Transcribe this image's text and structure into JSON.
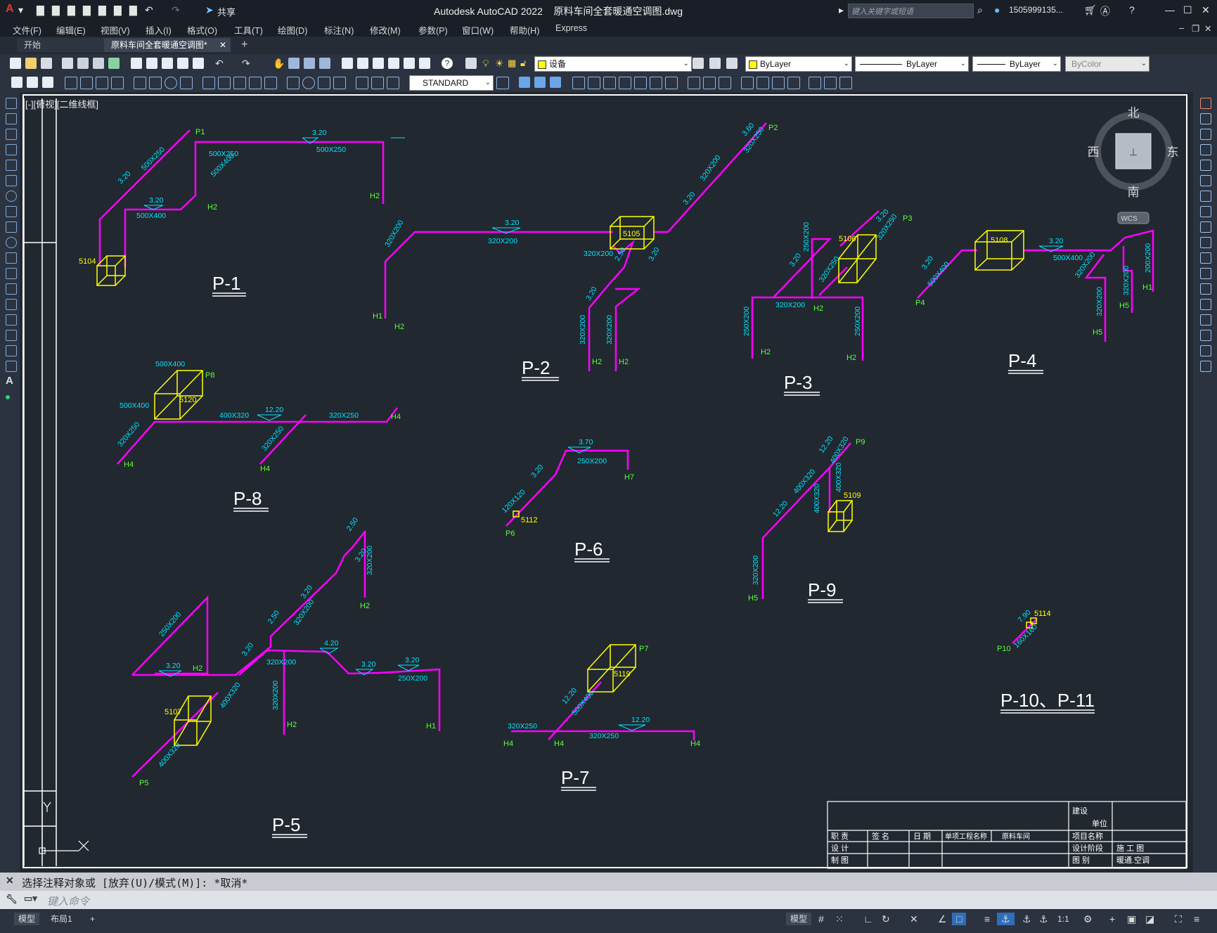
{
  "app": {
    "logo": "A",
    "title": "Autodesk AutoCAD 2022    原料车间全套暖通空调图.dwg",
    "share_label": "共享",
    "search_placeholder": "键入关键字或短语",
    "user": "1505999135...",
    "colors": {
      "duct": "#ff00ff",
      "text": "#00e5ff",
      "label": "#5cff3a",
      "equip": "#ffff00",
      "bg": "#212830"
    }
  },
  "menu": [
    "文件(F)",
    "编辑(E)",
    "视图(V)",
    "插入(I)",
    "格式(O)",
    "工具(T)",
    "绘图(D)",
    "标注(N)",
    "修改(M)",
    "参数(P)",
    "窗口(W)",
    "帮助(H)",
    "Express"
  ],
  "tabs": {
    "start": "开始",
    "active": "原料车间全套暖通空调图*",
    "add": "+"
  },
  "toolbar": {
    "layer": "设备",
    "color": "ByLayer",
    "linetype": "ByLayer",
    "lineweight": "ByLayer",
    "plotstyle": "ByColor",
    "textstyle": "STANDARD"
  },
  "viewport": {
    "label": "[-][俯视][二维线框]",
    "compass": {
      "n": "北",
      "s": "南",
      "e": "东",
      "w": "西"
    },
    "ucs": "WCS"
  },
  "drawing": {
    "systems": [
      "P-1",
      "P-2",
      "P-3",
      "P-4",
      "P-5",
      "P-6",
      "P-7",
      "P-8",
      "P-9",
      "P-10、P-11"
    ],
    "equipment": [
      "5104",
      "5105",
      "5106",
      "5107",
      "5108",
      "5109",
      "5112",
      "5114",
      "5119",
      "5120"
    ],
    "duct_sizes": [
      "500X250",
      "500X400",
      "320X200",
      "320X250",
      "400X320",
      "250X200",
      "200X200",
      "160X160",
      "120X120"
    ],
    "elevations": [
      "3.20",
      "3.60",
      "3.70",
      "4.20",
      "2.50",
      "12.20",
      "7.90"
    ],
    "points": [
      "P1",
      "P2",
      "P3",
      "P4",
      "P5",
      "P6",
      "P7",
      "P8",
      "P9",
      "P10",
      "H1",
      "H2",
      "H4",
      "H5",
      "H7"
    ]
  },
  "titleblock": {
    "construction": "建设",
    "unit": "单位",
    "headers": [
      "职 责",
      "签 名",
      "日 期",
      "单项工程名称",
      "原料车间"
    ],
    "rows": [
      "设 计",
      "制 图"
    ],
    "right": [
      [
        "项目名称",
        ""
      ],
      [
        "设计阶段",
        "施 工 图"
      ],
      [
        "图 别",
        "暖通.空调"
      ]
    ]
  },
  "command": {
    "history": "选择注释对象或 [放弃(U)/模式(M)]: *取消*",
    "placeholder": "键入命令"
  },
  "status": {
    "model": "模型",
    "layout1": "布局1",
    "add": "+",
    "scale": "1:1"
  }
}
